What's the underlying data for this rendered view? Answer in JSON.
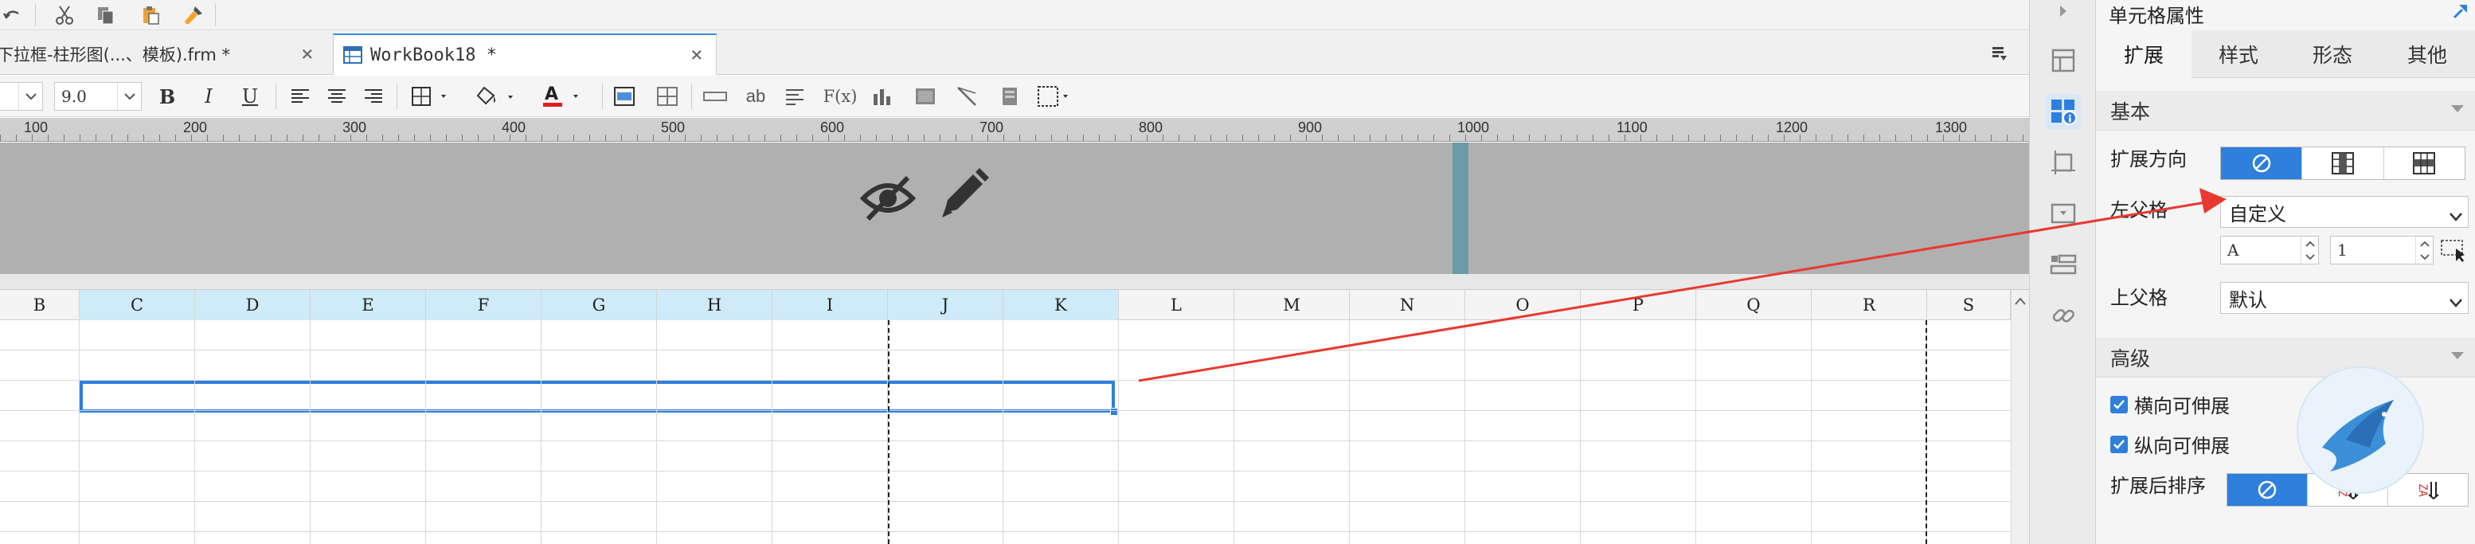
{
  "toolbar": {
    "undo_icon": "undo-icon",
    "cut_icon": "cut-icon",
    "copy_icon": "copy-icon",
    "paste_icon": "paste-icon",
    "format_painter_icon": "format-painter-icon"
  },
  "tabs": [
    {
      "label": "下拉框-柱形图(...、模板).frm *",
      "close": "×",
      "active": false
    },
    {
      "label": "WorkBook18 *",
      "close": "×",
      "active": true
    }
  ],
  "format": {
    "font_size": "9.0",
    "bold": "B",
    "italic": "I",
    "underline": "U",
    "text_glyph": "ab",
    "formula_glyph": "F(x)"
  },
  "ruler": {
    "labels": [
      "100",
      "200",
      "300",
      "400",
      "500",
      "600",
      "700",
      "800",
      "900",
      "1000",
      "1100",
      "1200",
      "1300"
    ]
  },
  "columns": [
    "B",
    "C",
    "D",
    "E",
    "F",
    "G",
    "H",
    "I",
    "J",
    "K",
    "L",
    "M",
    "N",
    "O",
    "P",
    "Q",
    "R",
    "S"
  ],
  "selected_columns": [
    "C",
    "D",
    "E",
    "F",
    "G",
    "H",
    "I",
    "J",
    "K"
  ],
  "icon_strip": [
    "cell-element-icon",
    "cell-attribute-icon",
    "float-element-icon",
    "widget-icon",
    "condition-icon",
    "hyperlink-icon"
  ],
  "panel": {
    "title": "单元格属性",
    "tabs": [
      "扩展",
      "样式",
      "形态",
      "其他"
    ],
    "active_tab": "扩展",
    "basic": {
      "section": "基本",
      "expand_direction_label": "扩展方向",
      "left_parent_label": "左父格",
      "left_parent_value": "自定义",
      "left_parent_col": "A",
      "left_parent_row": "1",
      "top_parent_label": "上父格",
      "top_parent_value": "默认"
    },
    "advanced": {
      "section": "高级",
      "horizontal_expandable": "横向可伸展",
      "vertical_expandable": "纵向可伸展",
      "sort_after_expand_label": "扩展后排序",
      "sort_asc_glyph": "AZ",
      "sort_desc_glyph": "ZA"
    }
  },
  "colors": {
    "accent": "#2f7fdc",
    "selection_header": "#cfeaf8",
    "annotation_arrow": "#e8382f",
    "hidden_area": "#b0b0b0"
  }
}
